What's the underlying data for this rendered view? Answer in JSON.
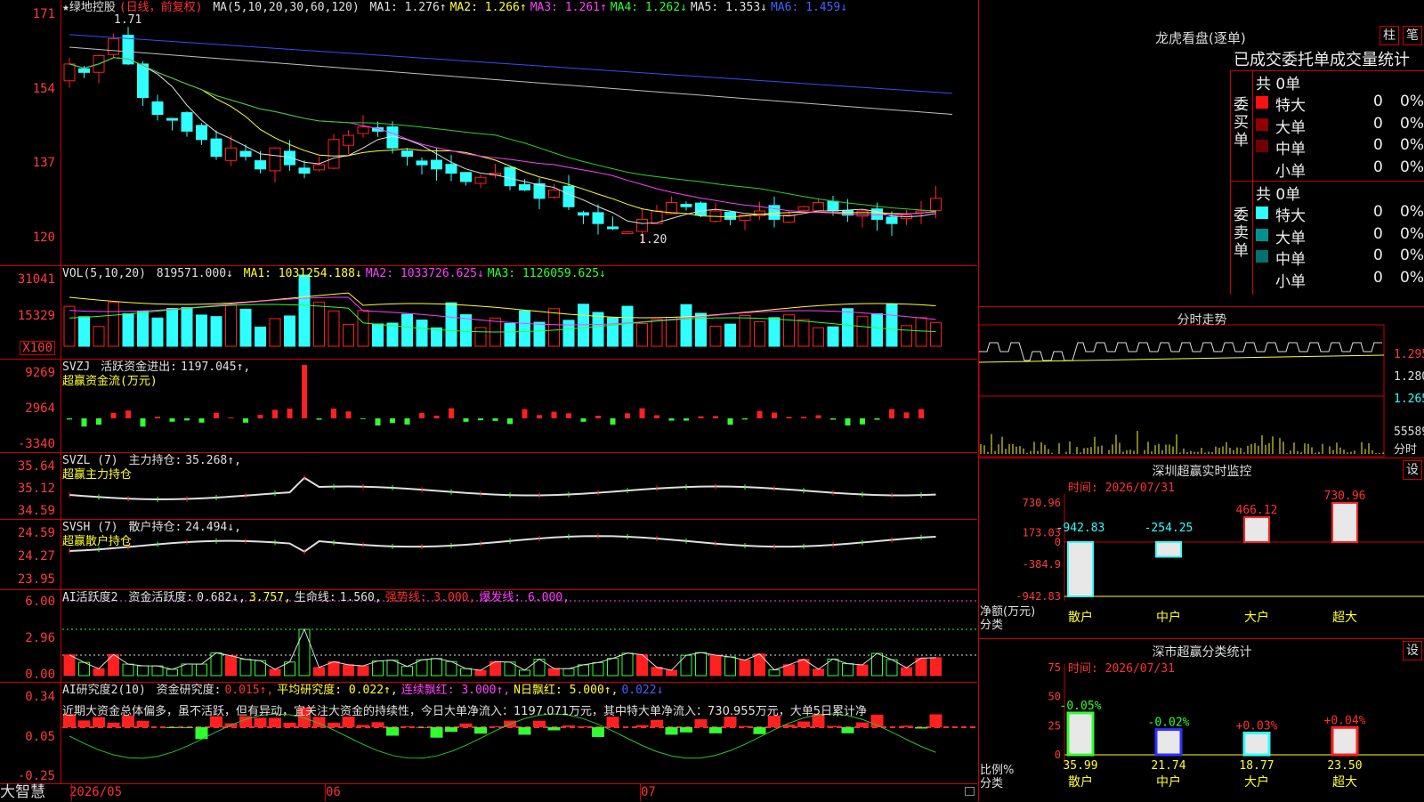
{
  "stock": {
    "title": "★绿地控股",
    "period": "(日线，前复权)",
    "high_mark": "1.71",
    "low_mark": "1.20"
  },
  "colors": {
    "up": "#ff2020",
    "down": "#30ffff",
    "ma1": "#e0e0e0",
    "ma2": "#ffff30",
    "ma3": "#ff40ff",
    "ma4": "#30d030",
    "ma5": "#c0c0c0",
    "ma6": "#3050ff"
  },
  "price_pane": {
    "y_labels": [
      "171",
      "154",
      "137",
      "120"
    ],
    "ma_header": "MA(5,10,20,30,60,120)",
    "ma": [
      {
        "label": "MA1:",
        "value": "1.276↑",
        "color": "#e0e0e0"
      },
      {
        "label": "MA2:",
        "value": "1.266↑",
        "color": "#ffff30"
      },
      {
        "label": "MA3:",
        "value": "1.261↑",
        "color": "#ff40ff"
      },
      {
        "label": "MA4:",
        "value": "1.262↓",
        "color": "#30ff30"
      },
      {
        "label": "MA5:",
        "value": "1.353↓",
        "color": "#e0e0e0"
      },
      {
        "label": "MA6:",
        "value": "1.459↓",
        "color": "#4060ff"
      }
    ]
  },
  "vol_pane": {
    "y_labels": [
      "31041",
      "15329",
      "X100"
    ],
    "header": "VOL(5,10,20)",
    "value": "819571.000↓",
    "ma": [
      {
        "label": "MA1:",
        "value": "1031254.188↓",
        "color": "#ffff30"
      },
      {
        "label": "MA2:",
        "value": "1033726.625↓",
        "color": "#ff40ff"
      },
      {
        "label": "MA3:",
        "value": "1126059.625↓",
        "color": "#30ff30"
      }
    ]
  },
  "svzj_pane": {
    "y_labels": [
      "9269",
      "2964",
      "-3340"
    ],
    "name": "SVZJ",
    "label": "活跃资金进出:",
    "value": "1197.045↑,",
    "subtitle": "超赢资金流(万元)"
  },
  "svzl_pane": {
    "y_labels": [
      "35.64",
      "35.12",
      "34.59"
    ],
    "name": "SVZL (7)",
    "label": "主力持仓:",
    "value": "35.268↑,",
    "subtitle": "超赢主力持仓"
  },
  "svsh_pane": {
    "y_labels": [
      "24.59",
      "24.27",
      "23.95"
    ],
    "name": "SVSH (7)",
    "label": "散户持仓:",
    "value": "24.494↓,",
    "subtitle": "超赢散户持仓"
  },
  "ai1_pane": {
    "y_labels": [
      "6.00",
      "2.96",
      "0.00"
    ],
    "name": "AI活跃度2",
    "label": "资金活跃度:",
    "v1": "0.682↓,",
    "v2": "3.757,",
    "label2": "生命线:",
    "v3": "1.560,",
    "strong": "强势线: 3.000,",
    "burst": "爆发线: 6.000,"
  },
  "ai2_pane": {
    "y_labels": [
      "0.34",
      "0.05",
      "-0.25"
    ],
    "name": "AI研究度2(10)",
    "label": "资金研究度:",
    "v1": "0.015↑,",
    "avg": "平均研究度: 0.022↑,",
    "cont": "连续飘红: 3.000↑,",
    "nday": "N日飘红: 5.000↑,",
    "v5": "0.022↓",
    "note": "近期大资金总体偏多，虽不活跃，但有异动，宜关注大资金的持续性，今日大单净流入：1197.071万元，其中特大单净流入：730.955万元，大单5日累计净"
  },
  "xaxis": {
    "labels": [
      "2026/05",
      "06",
      "07"
    ]
  },
  "brand": "大智慧",
  "right": {
    "dragon_title": "龙虎看盘(逐单)",
    "btn1": "柱",
    "btn2": "笔",
    "stats_title": "已成交委托单成交量统计",
    "buy_side": "委买单",
    "sell_side": "委卖单",
    "buy_total": "共 0单",
    "sell_total": "共 0单",
    "buy_rows": [
      {
        "name": "特大",
        "count": "0",
        "pct": "0%",
        "color": "#ff1010"
      },
      {
        "name": "大单",
        "count": "0",
        "pct": "0%",
        "color": "#900000"
      },
      {
        "name": "中单",
        "count": "0",
        "pct": "0%",
        "color": "#700000"
      },
      {
        "name": "小单",
        "count": "0",
        "pct": "0%",
        "color": "#000000"
      }
    ],
    "sell_rows": [
      {
        "name": "特大",
        "count": "0",
        "pct": "0%",
        "color": "#30ffff"
      },
      {
        "name": "大单",
        "count": "0",
        "pct": "0%",
        "color": "#009090"
      },
      {
        "name": "中单",
        "count": "0",
        "pct": "0%",
        "color": "#007070"
      },
      {
        "name": "小单",
        "count": "0",
        "pct": "0%",
        "color": "#000000"
      }
    ],
    "fenshi_title": "分时走势",
    "fenshi_labels": [
      "1.295",
      "1.280",
      "1.265",
      "55589",
      "分时"
    ],
    "sz_title": "深圳超赢实时监控",
    "sz_btn": "设",
    "sz_time": "时间: 2026/07/31",
    "sz_y": [
      "730.96",
      "173.03",
      "0",
      "-384.9",
      "-942.83"
    ],
    "sz_cats": [
      "散户",
      "中户",
      "大户",
      "超大"
    ],
    "sz_values": [
      -942.83,
      -254.25,
      466.12,
      730.96
    ],
    "sz_value_labels": [
      "-942.83",
      "-254.25",
      "466.12",
      "730.96"
    ],
    "sz_unit": "净额(万元)",
    "sz_unit2": "分类",
    "sc_title": "深市超赢分类统计",
    "sc_btn": "设",
    "sc_time": "时间: 2026/07/31",
    "sc_y": [
      "75",
      "50",
      "25",
      "0"
    ],
    "sc_cats": [
      "散户",
      "中户",
      "大户",
      "超大"
    ],
    "sc_values": [
      35.99,
      21.74,
      18.77,
      23.5
    ],
    "sc_value_labels": [
      "35.99",
      "21.74",
      "18.77",
      "23.50"
    ],
    "sc_changes": [
      "-0.05%",
      "-0.02%",
      "+0.03%",
      "+0.04%"
    ],
    "sc_unit": "比例%",
    "sc_unit2": "分类"
  },
  "chart_data": [
    {
      "type": "bar",
      "title": "深圳超赢实时监控",
      "categories": [
        "散户",
        "中户",
        "大户",
        "超大"
      ],
      "values": [
        -942.83,
        -254.25,
        466.12,
        730.96
      ],
      "ylabel": "净额(万元)",
      "ylim": [
        -942.83,
        730.96
      ]
    },
    {
      "type": "bar",
      "title": "深市超赢分类统计",
      "categories": [
        "散户",
        "中户",
        "大户",
        "超大"
      ],
      "values": [
        35.99,
        21.74,
        18.77,
        23.5
      ],
      "ylabel": "比例%",
      "ylim": [
        0,
        75
      ]
    }
  ]
}
